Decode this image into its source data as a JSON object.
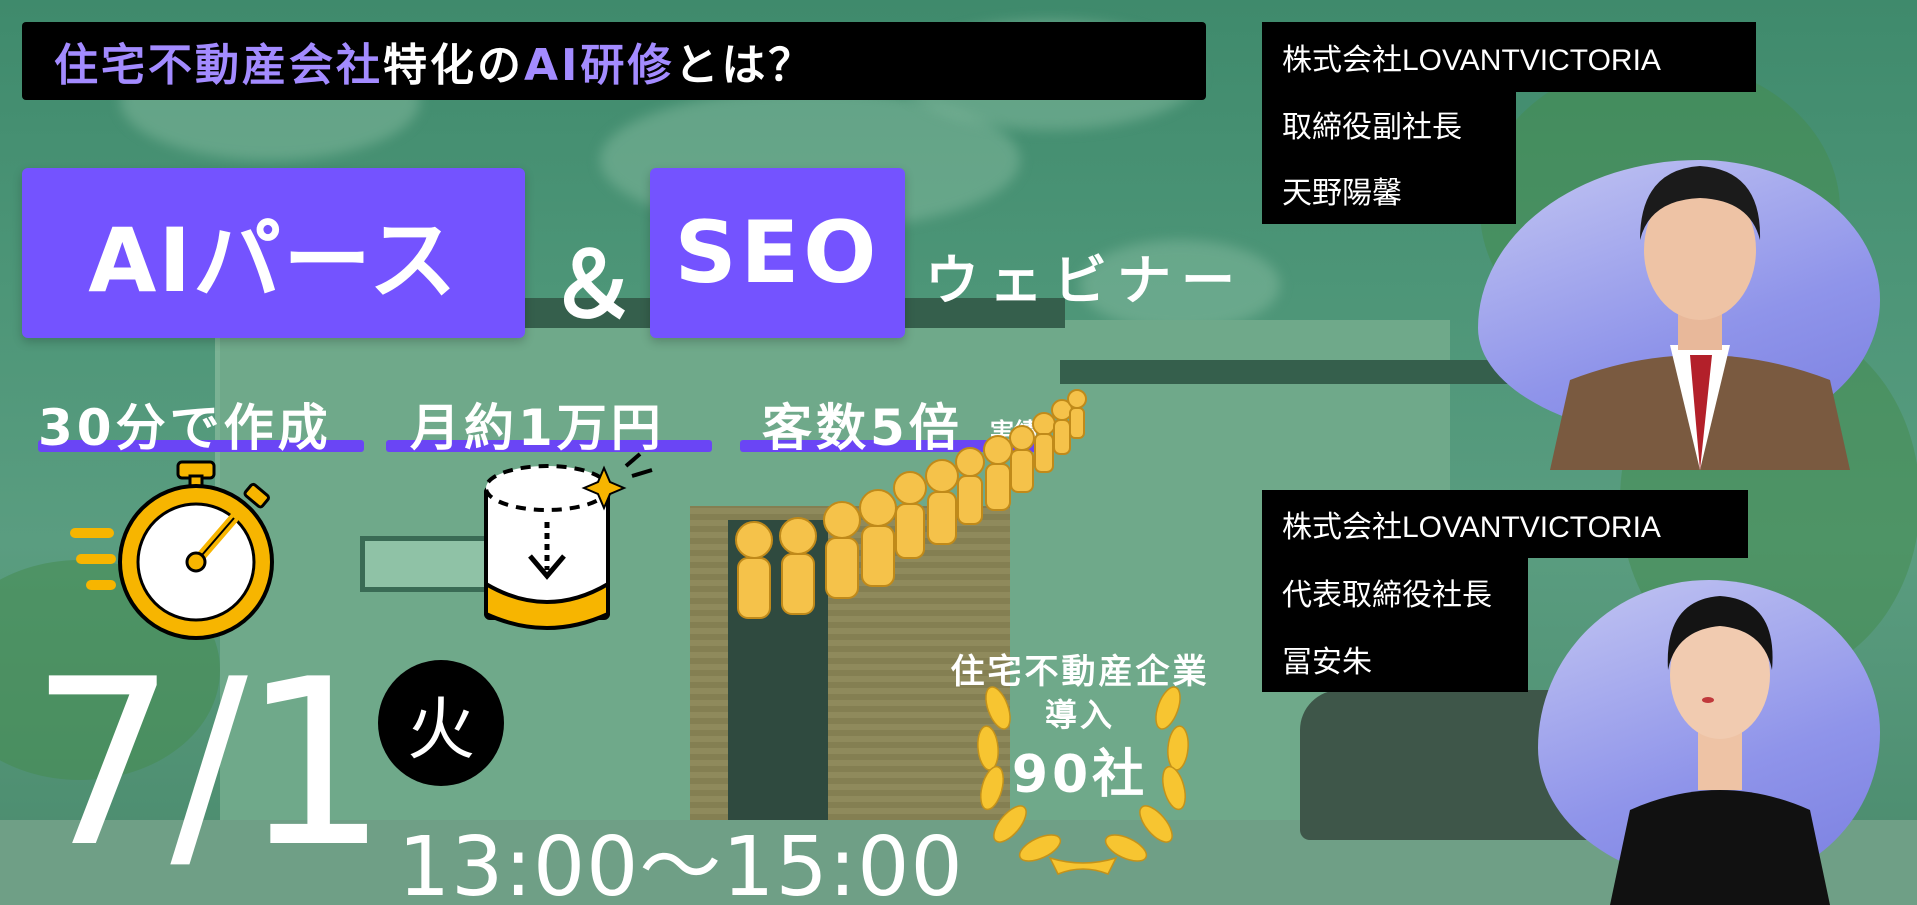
{
  "banner": {
    "title_part1": "住宅不動産会社",
    "title_part2": "特化の",
    "title_part3": "AI研修",
    "title_part4": "とは？"
  },
  "headline": {
    "ai_pers": "AIパース",
    "amp": "＆",
    "seo": "SEO",
    "webinar": "ウェビナー"
  },
  "features": {
    "item1": "30分で作成",
    "item2": "月約1万円",
    "item3": "客数5倍",
    "item3_suffix": "実績"
  },
  "badge": {
    "line1": "住宅不動産企業",
    "line2": "導入",
    "line3": "90社"
  },
  "event": {
    "date": "7/1",
    "weekday": "火",
    "time": "13:00〜15:00"
  },
  "speakers": [
    {
      "company": "株式会社LOVANTVICTORIA",
      "role": "取締役副社長",
      "name": "天野陽馨"
    },
    {
      "company": "株式会社LOVANTVICTORIA",
      "role": "代表取締役社長",
      "name": "冨安朱"
    }
  ],
  "colors": {
    "accent_purple": "#7453ff",
    "banner_purple_text": "#a38bff",
    "icon_gold": "#f7b500",
    "background_green": "#4c9577"
  },
  "icons": [
    "stopwatch-icon",
    "cylinder-download-icon",
    "crowd-queue-icon",
    "laurel-wreath-icon"
  ]
}
